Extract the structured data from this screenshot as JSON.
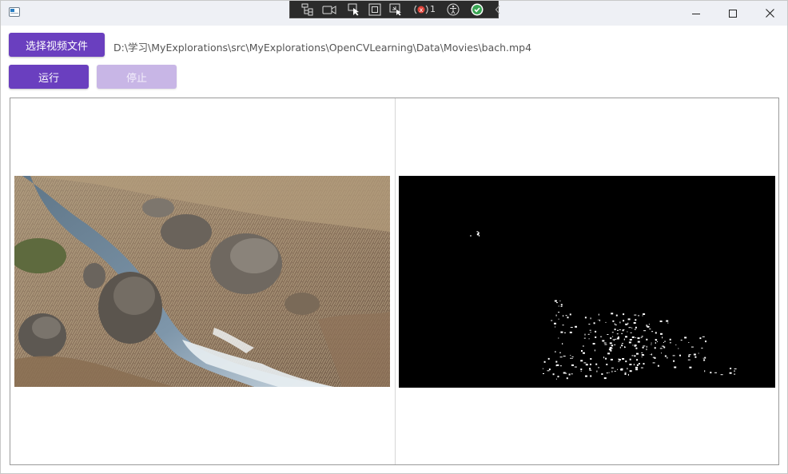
{
  "window": {
    "minimize_icon": "minimize-icon",
    "maximize_icon": "maximize-icon",
    "close_icon": "close-icon"
  },
  "debug_toolbar": {
    "badge_count": "1"
  },
  "controls": {
    "select_file_label": "选择视频文件",
    "file_path": "D:\\学习\\MyExplorations\\src\\MyExplorations\\OpenCVLearning\\Data\\Movies\\bach.mp4",
    "run_label": "运行",
    "stop_label": "停止"
  },
  "colors": {
    "primary": "#6a3fbf",
    "primary_disabled": "#c8b6e6",
    "titlebar": "#eef0f5"
  }
}
